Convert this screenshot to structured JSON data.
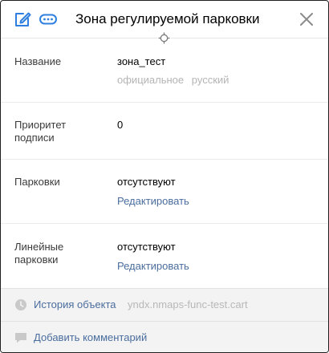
{
  "header": {
    "title": "Зона регулируемой парковки"
  },
  "fields": {
    "name": {
      "label": "Название",
      "value": "зона_тест",
      "hint_official": "официальное",
      "hint_lang": "русский"
    },
    "priority": {
      "label_line1": "Приоритет",
      "label_line2": "подписи",
      "value": "0"
    },
    "parkings": {
      "label": "Парковки",
      "value": "отсутствуют",
      "edit_label": "Редактировать"
    },
    "linear_parkings": {
      "label_line1": "Линейные",
      "label_line2": "парковки",
      "value": "отсутствуют",
      "edit_label": "Редактировать"
    }
  },
  "footer": {
    "history_label": "История объекта",
    "history_source": "yndx.nmaps-func-test.cart",
    "comment_label": "Добавить комментарий"
  },
  "colors": {
    "accent": "#2f7fe0",
    "link": "#4a6d9e",
    "muted": "#b5b5b5"
  },
  "icons": {
    "edit": "edit-icon",
    "more": "more-icon",
    "close": "close-icon",
    "target": "target-icon",
    "history": "clock-icon",
    "comment": "comment-icon"
  }
}
